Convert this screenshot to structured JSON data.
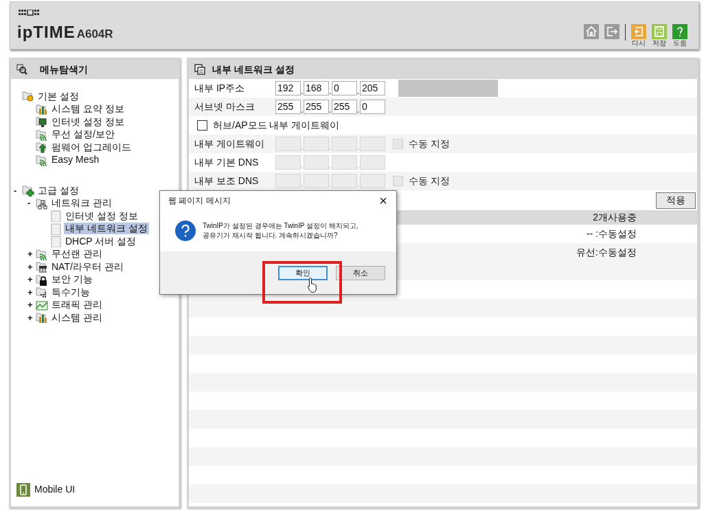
{
  "header": {
    "logo_text": "ipTIME",
    "model": "A604R",
    "toolbar": [
      {
        "kind": "home"
      },
      {
        "kind": "logout"
      },
      {
        "kind": "undo",
        "label": "다시"
      },
      {
        "kind": "save",
        "label": "저장"
      },
      {
        "kind": "help",
        "label": "도움"
      }
    ]
  },
  "sidebar": {
    "title": "메뉴탐색기",
    "tree": [
      {
        "label": "기본 설정",
        "kind": "folder-gear",
        "selected": false,
        "children": [
          {
            "label": "시스템 요약 정보",
            "kind": "chart",
            "selected": false
          },
          {
            "label": "인터넷 설정 정보",
            "kind": "monitor",
            "selected": false
          },
          {
            "label": "무선 설정/보안",
            "kind": "wifi",
            "selected": false
          },
          {
            "label": "펌웨어 업그레이드",
            "kind": "upload",
            "selected": false
          },
          {
            "label": "Easy Mesh",
            "kind": "wifi",
            "selected": false
          }
        ]
      },
      {
        "label": "고급 설정",
        "kind": "folder-plus",
        "toggle": "-",
        "selected": false,
        "children": [
          {
            "label": "네트워크 관리",
            "kind": "network",
            "toggle": "-",
            "selected": false,
            "children": [
              {
                "label": "인터넷 설정 정보",
                "kind": "page",
                "selected": false
              },
              {
                "label": "내부 네트워크 설정",
                "kind": "page",
                "selected": true
              },
              {
                "label": "DHCP 서버 설정",
                "kind": "page",
                "selected": false
              }
            ]
          },
          {
            "label": "무선랜 관리",
            "kind": "wifi",
            "toggle": "+",
            "selected": false
          },
          {
            "label": "NAT/라우터 관리",
            "kind": "router",
            "toggle": "+",
            "selected": false
          },
          {
            "label": "보안 기능",
            "kind": "lock",
            "toggle": "+",
            "selected": false
          },
          {
            "label": "특수기능",
            "kind": "grid",
            "toggle": "+",
            "selected": false
          },
          {
            "label": "트래픽 관리",
            "kind": "mail",
            "toggle": "+",
            "selected": false
          },
          {
            "label": "시스템 관리",
            "kind": "chart",
            "toggle": "+",
            "selected": false
          }
        ]
      }
    ],
    "mobile_link": "Mobile UI"
  },
  "main": {
    "title": "내부 네트워크 설정",
    "rows": [
      {
        "kind": "ip",
        "label": "내부 IP주소",
        "octets": [
          "192",
          "168",
          "0",
          "205"
        ],
        "separators": [
          ".",
          ".",
          "."
        ],
        "disabled": false,
        "masked": true
      },
      {
        "kind": "ip",
        "label": "서브넷 마스크",
        "octets": [
          "255",
          "255",
          "255",
          "0"
        ],
        "separators": [
          ".",
          ".",
          "."
        ],
        "disabled": false
      },
      {
        "kind": "checkbox",
        "label": "허브/AP모드 내부 게이트웨이",
        "checked": false
      },
      {
        "kind": "ip",
        "label": "내부 게이트웨이",
        "separators": [
          ".",
          ".",
          "."
        ],
        "disabled": true,
        "manual": {
          "label": "수동 지정",
          "checked": false,
          "disabled": true
        }
      },
      {
        "kind": "ip",
        "label": "내부 기본 DNS",
        "separators": [
          ".",
          ".",
          "."
        ],
        "disabled": true
      },
      {
        "kind": "ip",
        "label": "내부 보조 DNS",
        "separators": [
          ".",
          ".",
          "."
        ],
        "disabled": true,
        "manual": {
          "label": "수동 지정",
          "checked": false,
          "disabled": true
        }
      }
    ],
    "apply_button": "적용",
    "list": [
      {
        "kind": "header",
        "text": "2개사용중"
      },
      {
        "kind": "row",
        "text": "-- :수동설정"
      },
      {
        "kind": "row",
        "text": "유선:수동설정"
      }
    ]
  },
  "dialog": {
    "title": "웹 페이지 메시지",
    "close": "×",
    "message": [
      "TwinIP가 설정된 경우에는 TwinIP 설정이 해지되고,",
      "공유기가 재시작 됩니다. 계속하시겠습니까?"
    ],
    "buttons": [
      {
        "label": "확인",
        "focused": true
      },
      {
        "label": "취소",
        "focused": false
      }
    ]
  }
}
